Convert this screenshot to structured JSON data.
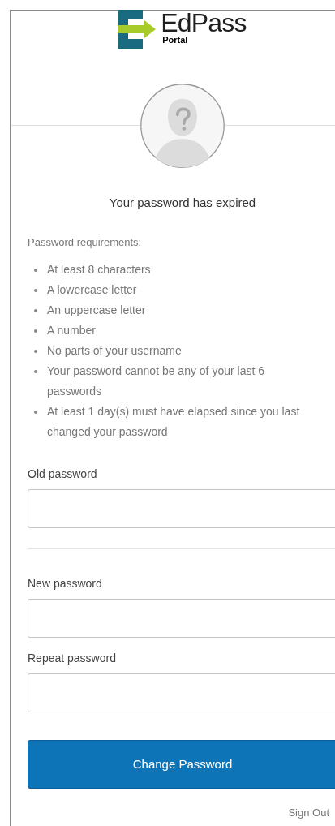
{
  "logo": {
    "name": "EdPass",
    "subtitle": "Portal"
  },
  "title": "Your password has expired",
  "requirements": {
    "heading": "Password requirements:",
    "items": [
      "At least 8 characters",
      "A lowercase letter",
      "An uppercase letter",
      "A number",
      "No parts of your username",
      "Your password cannot be any of your last 6 passwords",
      "At least 1 day(s) must have elapsed since you last changed your password"
    ]
  },
  "fields": [
    {
      "label": "Old password",
      "divider_after": true
    },
    {
      "label": "New password",
      "divider_after": false
    },
    {
      "label": "Repeat password",
      "divider_after": false
    }
  ],
  "submit": "Change Password",
  "sign_out": "Sign Out"
}
